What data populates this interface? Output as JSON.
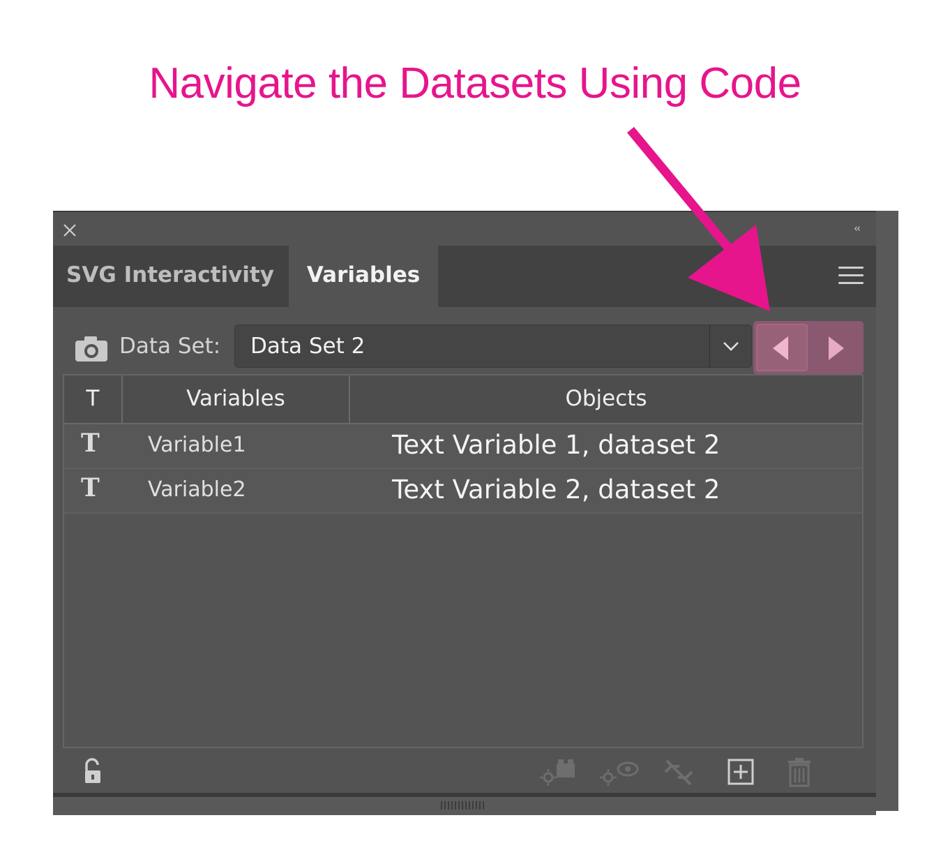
{
  "annotation": {
    "callout_text": "Navigate the Datasets Using Code",
    "color": "#e6158c"
  },
  "panel": {
    "tabs": [
      {
        "label": "SVG Interactivity",
        "active": false
      },
      {
        "label": "Variables",
        "active": true
      }
    ],
    "dataset": {
      "label": "Data Set:",
      "selected": "Data Set 2"
    },
    "table": {
      "headers": [
        "T",
        "Variables",
        "Objects"
      ],
      "rows": [
        {
          "type_icon": "T",
          "variable": "Variable1",
          "object": "Text Variable 1, dataset 2"
        },
        {
          "type_icon": "T",
          "variable": "Variable2",
          "object": "Text Variable 2, dataset 2"
        }
      ]
    },
    "icons": {
      "close": "close-icon",
      "collapse": "collapse-icon",
      "menu": "panel-menu-icon",
      "camera": "capture-dataset-icon",
      "prev": "previous-dataset-icon",
      "next": "next-dataset-icon",
      "lock": "unlock-icon",
      "footer": [
        "make-visibility-dynamic-icon",
        "make-text-dynamic-icon",
        "unbind-variable-icon",
        "new-variable-icon",
        "delete-variable-icon"
      ]
    },
    "colors": {
      "panel_bg": "#535353",
      "nav_highlight": "#8a5870"
    }
  }
}
